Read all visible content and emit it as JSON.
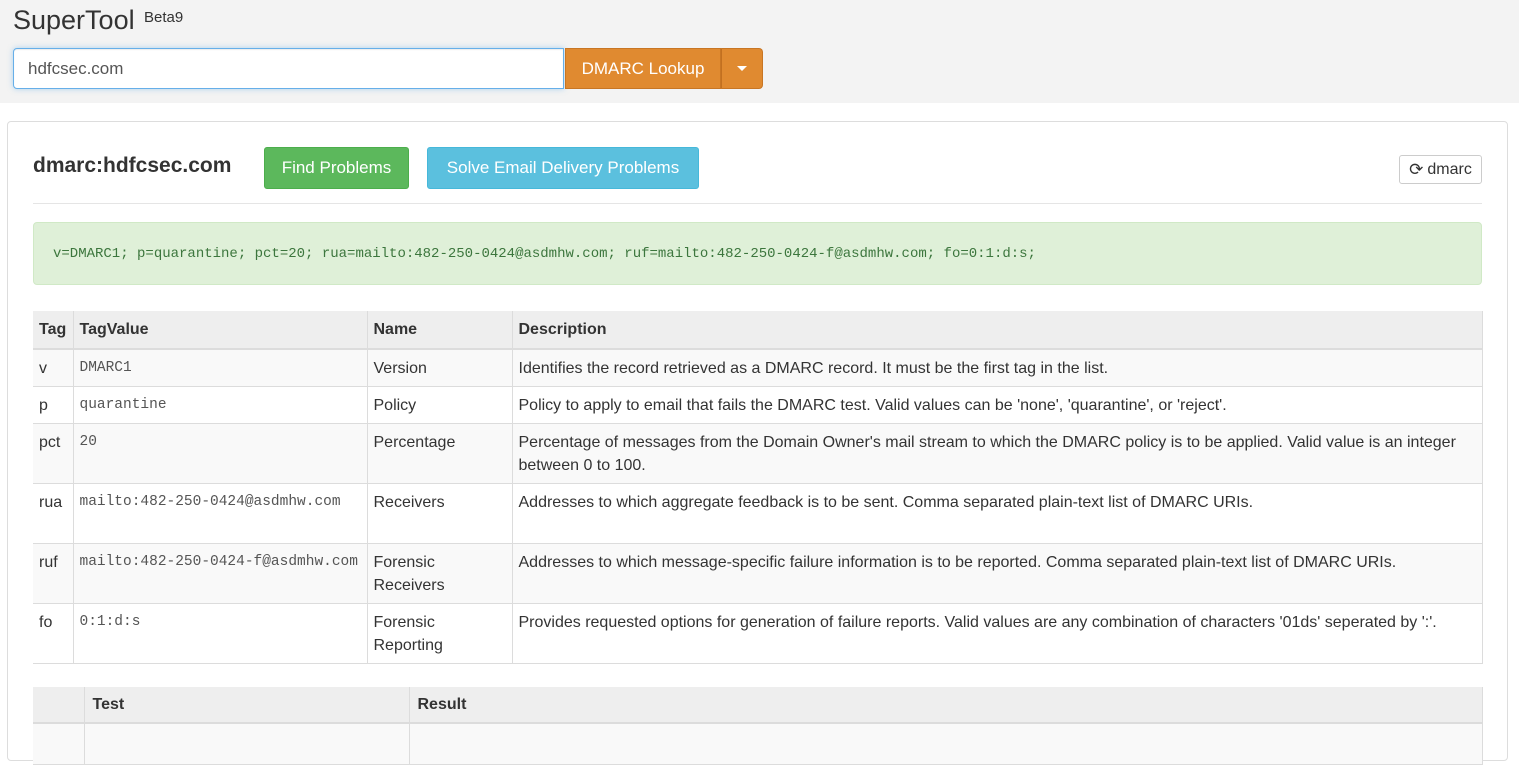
{
  "header": {
    "brand": "SuperTool",
    "badge": "Beta9",
    "search_value": "hdfcsec.com",
    "lookup_label": "DMARC Lookup"
  },
  "panel": {
    "title": "dmarc:hdfcsec.com",
    "find_problems_label": "Find Problems",
    "solve_label": "Solve Email Delivery Problems",
    "refresh_label": "dmarc",
    "record": "v=DMARC1; p=quarantine; pct=20; rua=mailto:482-250-0424@asdmhw.com; ruf=mailto:482-250-0424-f@asdmhw.com; fo=0:1:d:s;"
  },
  "tags_table": {
    "headers": [
      "Tag",
      "TagValue",
      "Name",
      "Description"
    ],
    "rows": [
      {
        "tag": "v",
        "value": "DMARC1",
        "name": "Version",
        "description": "Identifies the record retrieved as a DMARC record. It must be the first tag in the list."
      },
      {
        "tag": "p",
        "value": "quarantine",
        "name": "Policy",
        "description": "Policy to apply to email that fails the DMARC test. Valid values can be 'none', 'quarantine', or 'reject'."
      },
      {
        "tag": "pct",
        "value": "20",
        "name": "Percentage",
        "description": "Percentage of messages from the Domain Owner's mail stream to which the DMARC policy is to be applied. Valid value is an integer between 0 to 100."
      },
      {
        "tag": "rua",
        "value": "mailto:482-250-0424@asdmhw.com",
        "name": "Receivers",
        "description": "Addresses to which aggregate feedback is to be sent. Comma separated plain-text list of DMARC URIs."
      },
      {
        "tag": "ruf",
        "value": "mailto:482-250-0424-f@asdmhw.com",
        "name": "Forensic Receivers",
        "description": "Addresses to which message-specific failure information is to be reported. Comma separated plain-text list of DMARC URIs."
      },
      {
        "tag": "fo",
        "value": "0:1:d:s",
        "name": "Forensic Reporting",
        "description": "Provides requested options for generation of failure reports. Valid values are any combination of characters '01ds' seperated by ':'."
      }
    ]
  },
  "test_table": {
    "headers": [
      "",
      "Test",
      "Result"
    ]
  }
}
